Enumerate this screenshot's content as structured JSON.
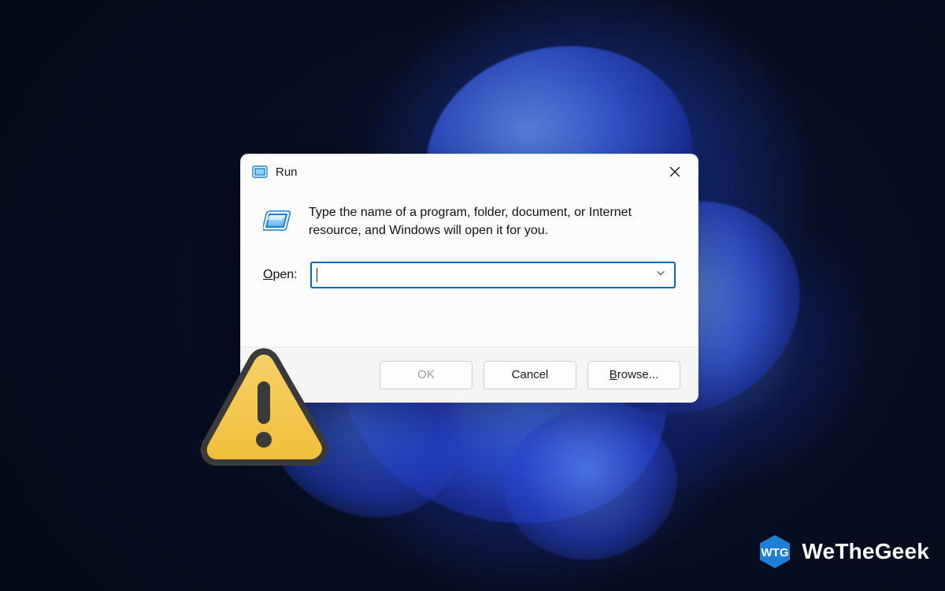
{
  "dialog": {
    "title": "Run",
    "description": "Type the name of a program, folder, document, or Internet resource, and Windows will open it for you.",
    "open_label_prefix": "O",
    "open_label_rest": "pen:",
    "input_value": "",
    "input_placeholder": "",
    "buttons": {
      "ok": "OK",
      "cancel": "Cancel",
      "browse_prefix": "B",
      "browse_rest": "rowse..."
    }
  },
  "icons": {
    "app_icon": "run-icon",
    "close": "close-icon",
    "run_big": "run-large-icon",
    "dropdown": "chevron-down-icon",
    "warning": "warning-icon"
  },
  "brand": {
    "name": "WeTheGeek",
    "badge_text": "WTG"
  },
  "colors": {
    "accent": "#0067c0",
    "warning_fill": "#f3c84d",
    "warning_stroke": "#3a3a3a",
    "brand_blue": "#1f7fd6"
  }
}
